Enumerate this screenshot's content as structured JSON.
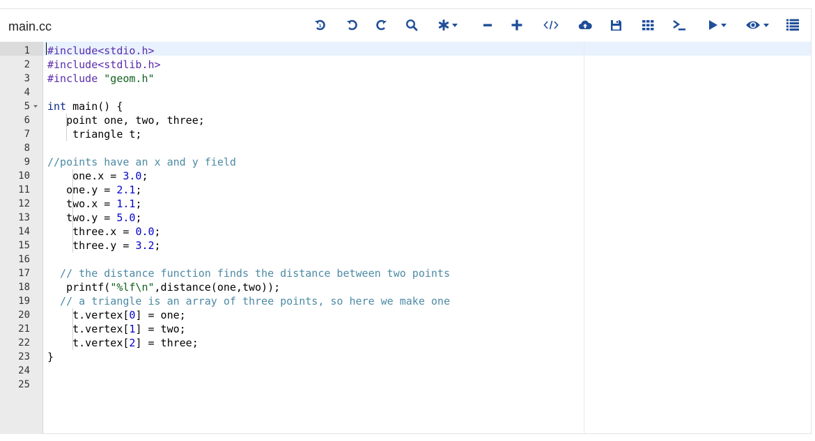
{
  "file": {
    "name": "main.cc"
  },
  "toolbar": {
    "buttons": [
      {
        "name": "undo-all-icon"
      },
      {
        "name": "undo-icon"
      },
      {
        "name": "redo-icon"
      },
      {
        "name": "search-icon"
      },
      {
        "name": "asterisk-dropdown-icon"
      },
      {
        "name": "zoom-out-icon"
      },
      {
        "name": "zoom-in-icon"
      },
      {
        "name": "code-embed-icon"
      },
      {
        "name": "cloud-upload-icon"
      },
      {
        "name": "save-icon"
      },
      {
        "name": "grid-icon"
      },
      {
        "name": "terminal-icon"
      },
      {
        "name": "run-dropdown-icon"
      },
      {
        "name": "visibility-dropdown-icon"
      },
      {
        "name": "list-icon"
      }
    ]
  },
  "editor": {
    "lines": [
      {
        "n": "1",
        "tokens": [
          {
            "t": "pre",
            "v": "#include<stdio.h>"
          }
        ]
      },
      {
        "n": "2",
        "tokens": [
          {
            "t": "pre",
            "v": "#include<stdlib.h>"
          }
        ]
      },
      {
        "n": "3",
        "tokens": [
          {
            "t": "pre",
            "v": "#include "
          },
          {
            "t": "str",
            "v": "\"geom.h\""
          }
        ]
      },
      {
        "n": "4",
        "tokens": []
      },
      {
        "n": "5",
        "tokens": [
          {
            "t": "kw",
            "v": "int"
          },
          {
            "t": "plain",
            "v": " main() {"
          }
        ]
      },
      {
        "n": "6",
        "tokens": [
          {
            "t": "plain",
            "v": "   point one, two, three;"
          }
        ]
      },
      {
        "n": "7",
        "tokens": [
          {
            "t": "plain",
            "v": "    triangle t;"
          }
        ]
      },
      {
        "n": "8",
        "tokens": []
      },
      {
        "n": "9",
        "tokens": [
          {
            "t": "cmt",
            "v": "//points have an x and y field"
          }
        ]
      },
      {
        "n": "10",
        "tokens": [
          {
            "t": "plain",
            "v": "    one.x = "
          },
          {
            "t": "num",
            "v": "3.0"
          },
          {
            "t": "plain",
            "v": ";"
          }
        ]
      },
      {
        "n": "11",
        "tokens": [
          {
            "t": "plain",
            "v": "   one.y = "
          },
          {
            "t": "num",
            "v": "2.1"
          },
          {
            "t": "plain",
            "v": ";"
          }
        ]
      },
      {
        "n": "12",
        "tokens": [
          {
            "t": "plain",
            "v": "   two.x = "
          },
          {
            "t": "num",
            "v": "1.1"
          },
          {
            "t": "plain",
            "v": ";"
          }
        ]
      },
      {
        "n": "13",
        "tokens": [
          {
            "t": "plain",
            "v": "   two.y = "
          },
          {
            "t": "num",
            "v": "5.0"
          },
          {
            "t": "plain",
            "v": ";"
          }
        ]
      },
      {
        "n": "14",
        "tokens": [
          {
            "t": "plain",
            "v": "    three.x = "
          },
          {
            "t": "num",
            "v": "0.0"
          },
          {
            "t": "plain",
            "v": ";"
          }
        ]
      },
      {
        "n": "15",
        "tokens": [
          {
            "t": "plain",
            "v": "    three.y = "
          },
          {
            "t": "num",
            "v": "3.2"
          },
          {
            "t": "plain",
            "v": ";"
          }
        ]
      },
      {
        "n": "16",
        "tokens": []
      },
      {
        "n": "17",
        "tokens": [
          {
            "t": "cmt",
            "v": "  // the distance function finds the distance between two points"
          }
        ]
      },
      {
        "n": "18",
        "tokens": [
          {
            "t": "plain",
            "v": "   printf("
          },
          {
            "t": "str",
            "v": "\"%lf\\n\""
          },
          {
            "t": "plain",
            "v": ",distance(one,two));"
          }
        ]
      },
      {
        "n": "19",
        "tokens": [
          {
            "t": "cmt",
            "v": "  // a triangle is an array of three points, so here we make one"
          }
        ]
      },
      {
        "n": "20",
        "tokens": [
          {
            "t": "plain",
            "v": "    t.vertex["
          },
          {
            "t": "num",
            "v": "0"
          },
          {
            "t": "plain",
            "v": "] = one;"
          }
        ]
      },
      {
        "n": "21",
        "tokens": [
          {
            "t": "plain",
            "v": "    t.vertex["
          },
          {
            "t": "num",
            "v": "1"
          },
          {
            "t": "plain",
            "v": "] = two;"
          }
        ]
      },
      {
        "n": "22",
        "tokens": [
          {
            "t": "plain",
            "v": "    t.vertex["
          },
          {
            "t": "num",
            "v": "2"
          },
          {
            "t": "plain",
            "v": "] = three;"
          }
        ]
      },
      {
        "n": "23",
        "tokens": [
          {
            "t": "plain",
            "v": "}"
          }
        ]
      },
      {
        "n": "24",
        "tokens": []
      },
      {
        "n": "25",
        "tokens": []
      }
    ]
  },
  "colors": {
    "accent": "#1f4e9a",
    "active_line": "#e8f2fe",
    "gutter": "#ebebeb"
  }
}
